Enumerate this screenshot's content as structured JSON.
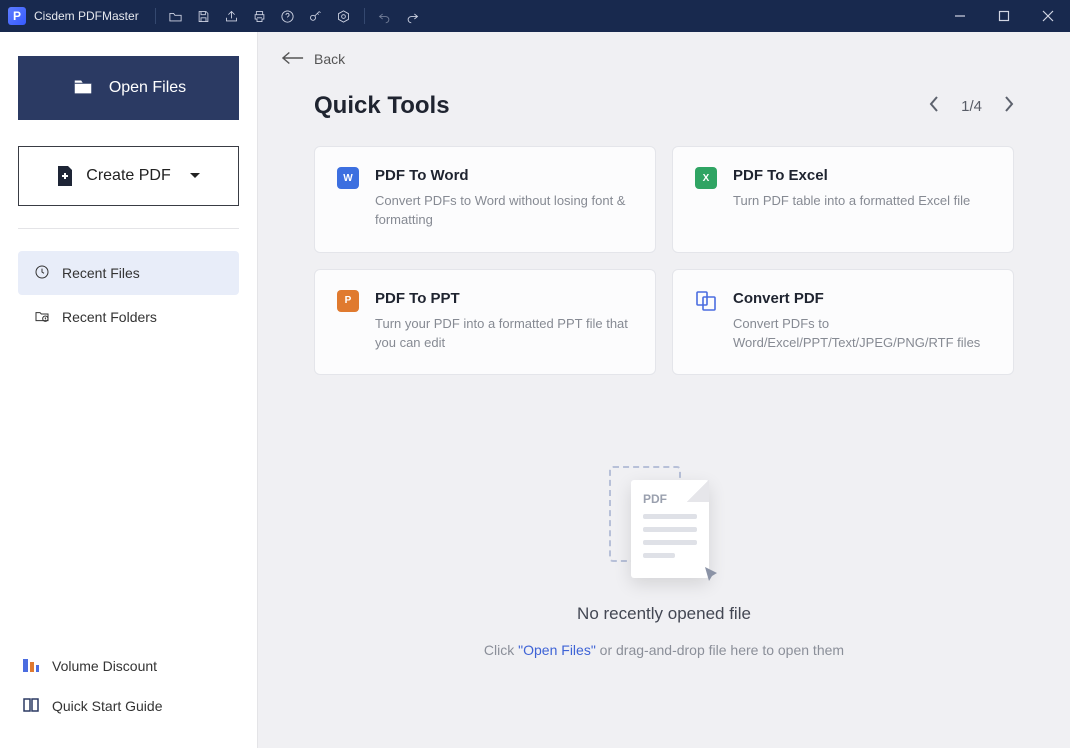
{
  "titlebar": {
    "app_name": "Cisdem PDFMaster",
    "logo_letter": "P"
  },
  "sidebar": {
    "open_files_label": "Open Files",
    "create_pdf_label": "Create PDF",
    "recent_files_label": "Recent Files",
    "recent_folders_label": "Recent Folders",
    "volume_discount_label": "Volume Discount",
    "quick_start_label": "Quick Start Guide"
  },
  "main": {
    "back_label": "Back",
    "heading": "Quick Tools",
    "pager_text": "1/4",
    "cards": [
      {
        "title": "PDF To Word",
        "desc": "Convert PDFs to Word without losing font & formatting",
        "icon_letter": "W"
      },
      {
        "title": "PDF To Excel",
        "desc": "Turn PDF table into a formatted Excel file",
        "icon_letter": "X"
      },
      {
        "title": "PDF To PPT",
        "desc": "Turn your PDF into a formatted PPT file that you can edit",
        "icon_letter": "P"
      },
      {
        "title": "Convert PDF",
        "desc": "Convert PDFs to Word/Excel/PPT/Text/JPEG/PNG/RTF files"
      }
    ],
    "dropzone": {
      "pdf_tag": "PDF",
      "title": "No recently opened file",
      "hint_prefix": "Click ",
      "hint_link": "\"Open Files\"",
      "hint_suffix": " or drag-and-drop file here to open them"
    }
  }
}
